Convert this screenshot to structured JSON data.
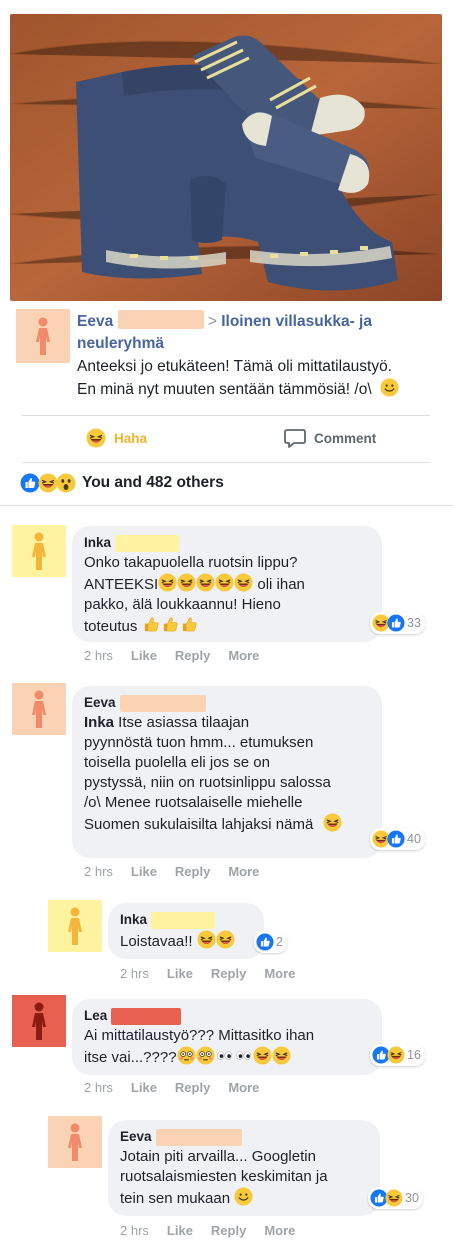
{
  "post": {
    "author": "Eeva",
    "arrow": ">",
    "group": "Iloinen villasukka- ja neuleryhmä",
    "text_line1": "Anteeksi jo etukäteen! Tämä oli mittatilaustyö.",
    "text_line2": "En minä nyt muuten sentään tämmösiä! /o\\",
    "avatar_color": "#f9d3b3",
    "redaction_color": "#f9d3b3"
  },
  "actions": {
    "haha_label": "Haha",
    "comment_label": "Comment"
  },
  "reactions_summary": {
    "text": "You and 482 others",
    "icons": [
      "like-icon",
      "haha-icon",
      "wow-icon"
    ]
  },
  "comments": [
    {
      "author": "Inka",
      "avatar_color": "#fff3a0",
      "redaction_color": "#fff3a0",
      "line1": "Onko takapuolella ruotsin lippu?",
      "line2_pre": "ANTEEKSI",
      "line2_post": " oli ihan",
      "line3": "pakko, älä loukkaannu! Hieno",
      "line4": "toteutus",
      "reaction_count": "33",
      "time": "2 hrs",
      "like": "Like",
      "reply": "Reply",
      "more": "More"
    },
    {
      "author": "Eeva",
      "avatar_color": "#f9d3b3",
      "redaction_color": "#f9d3b3",
      "mention": "Inka",
      "line1": " Itse asiassa tilaajan",
      "line2": "pyynnöstä tuon hmm... etumuksen",
      "line3": "toisella puolella eli jos se on",
      "line4": "pystyssä, niin on ruotsinlippu salossa",
      "line5": "/o\\ Menee ruotsalaiselle miehelle",
      "line6": "Suomen sukulaisilta lahjaksi nämä",
      "reaction_count": "40",
      "time": "2 hrs",
      "like": "Like",
      "reply": "Reply",
      "more": "More"
    },
    {
      "author": "Inka",
      "avatar_color": "#fff3a0",
      "redaction_color": "#fff3a0",
      "line1": "Loistavaa!!",
      "reaction_count": "2",
      "time": "2 hrs",
      "like": "Like",
      "reply": "Reply",
      "more": "More"
    },
    {
      "author": "Lea",
      "avatar_color": "#e8604f",
      "redaction_color": "#e8604f",
      "line1": "Ai mittatilaustyö??? Mittasitko ihan",
      "line2": "itse vai...????",
      "reaction_count": "16",
      "time": "2 hrs",
      "like": "Like",
      "reply": "Reply",
      "more": "More"
    },
    {
      "author": "Eeva",
      "avatar_color": "#f9d3b3",
      "redaction_color": "#f9d3b3",
      "line1": "Jotain piti arvailla... Googletin",
      "line2": "ruotsalaismiesten keskimitan ja",
      "line3": "tein sen mukaan",
      "reaction_count": "30",
      "time": "2 hrs",
      "like": "Like",
      "reply": "Reply",
      "more": "More"
    }
  ],
  "colors": {
    "link_blue": "#4a659e",
    "like_blue": "#1877f2",
    "haha_yellow": "#f7c93b",
    "meta_gray": "#a0a4aa",
    "bubble_gray": "#f0f1f4"
  }
}
